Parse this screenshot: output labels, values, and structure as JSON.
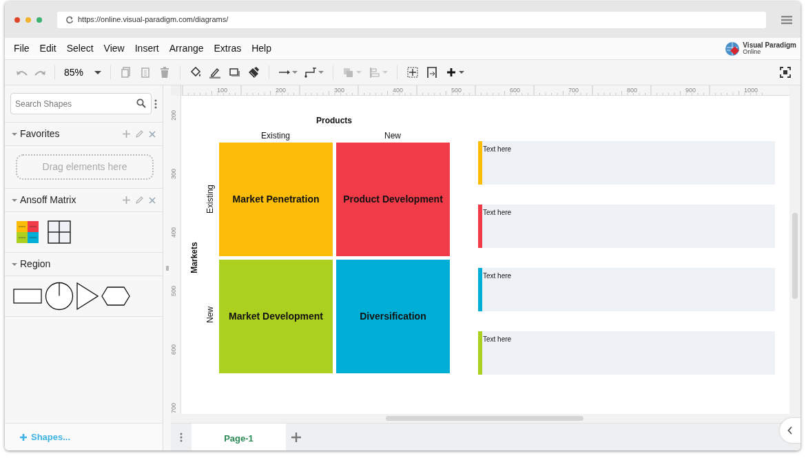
{
  "browser": {
    "url": "https://online.visual-paradigm.com/diagrams/"
  },
  "menu": [
    "File",
    "Edit",
    "Select",
    "View",
    "Insert",
    "Arrange",
    "Extras",
    "Help"
  ],
  "logo": {
    "name": "Visual Paradigm",
    "sub": "Online"
  },
  "toolbar": {
    "zoom": "85%"
  },
  "search": {
    "placeholder": "Search Shapes"
  },
  "sidebar": {
    "sections": [
      {
        "title": "Favorites",
        "expanded": true,
        "editable": true,
        "kind": "dropzone",
        "hint": "Drag elements here"
      },
      {
        "title": "Ansoff Matrix",
        "expanded": true,
        "editable": true,
        "kind": "matrix"
      },
      {
        "title": "Region",
        "expanded": true,
        "editable": false,
        "kind": "basic"
      }
    ],
    "more_link": "Shapes..."
  },
  "rulers": {
    "horizontal": [
      "100",
      "200",
      "300",
      "400",
      "500",
      "600",
      "700",
      "800",
      "900",
      "1000"
    ],
    "vertical": [
      "200",
      "300",
      "400",
      "500",
      "600",
      "700"
    ]
  },
  "diagram": {
    "title": "Products",
    "columns": [
      "Existing",
      "New"
    ],
    "axis_label": "Markets",
    "rows": [
      "Existing",
      "New"
    ],
    "quadrants": [
      {
        "label": "Market Penetration",
        "color": "#fbbd08"
      },
      {
        "label": "Product Development",
        "color": "#f23b49"
      },
      {
        "label": "Market Development",
        "color": "#acd020"
      },
      {
        "label": "Diversification",
        "color": "#00aed6"
      }
    ],
    "notes": [
      {
        "text": "Text here",
        "color": "#fbbd08"
      },
      {
        "text": "Text here",
        "color": "#f23b49"
      },
      {
        "text": "Text here",
        "color": "#00aed6"
      },
      {
        "text": "Text here",
        "color": "#acd020"
      }
    ]
  },
  "page_tabs": [
    {
      "label": "Page-1",
      "selected": true
    }
  ]
}
